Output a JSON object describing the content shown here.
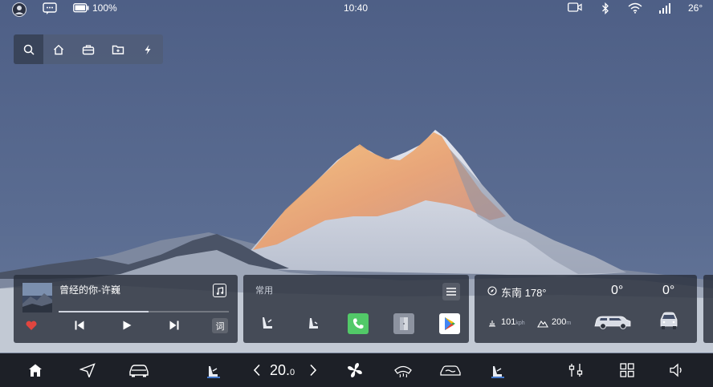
{
  "status_bar": {
    "battery": "100%",
    "time": "10:40",
    "temperature": "26°"
  },
  "music": {
    "song": "曾经的你-许巍",
    "lyrics_button": "词",
    "progress": 0.53
  },
  "apps_card": {
    "title": "常用"
  },
  "car_card": {
    "direction": "东南 178°",
    "angle_front": "0°",
    "angle_side": "0°",
    "speed_value": "101",
    "speed_unit": "kph",
    "altitude_value": "200",
    "altitude_unit": "m"
  },
  "dock": {
    "temperature": "20.",
    "temperature_decimal": "0"
  },
  "icons": {
    "status": [
      "avatar-icon",
      "message-icon",
      "battery-icon",
      "camera-icon",
      "bluetooth-icon",
      "wifi-icon",
      "signal-icon"
    ],
    "quick_bar": [
      "search-icon",
      "home-icon",
      "briefcase-icon",
      "folder-icon",
      "flash-icon"
    ],
    "dock": [
      "home-icon",
      "navigation-icon",
      "car-icon",
      "seat-heat-icon",
      "chevron-left-icon",
      "chevron-right-icon",
      "fan-icon",
      "defrost-icon",
      "car-air-icon",
      "seat-heat-right-icon",
      "controls-icon",
      "apps-grid-icon",
      "volume-icon"
    ]
  },
  "colors": {
    "sky": "#56678c",
    "card_bg": "#2a303c",
    "dock_bg": "#16181e",
    "heart": "#e0453f",
    "phone_app": "#52c968"
  }
}
